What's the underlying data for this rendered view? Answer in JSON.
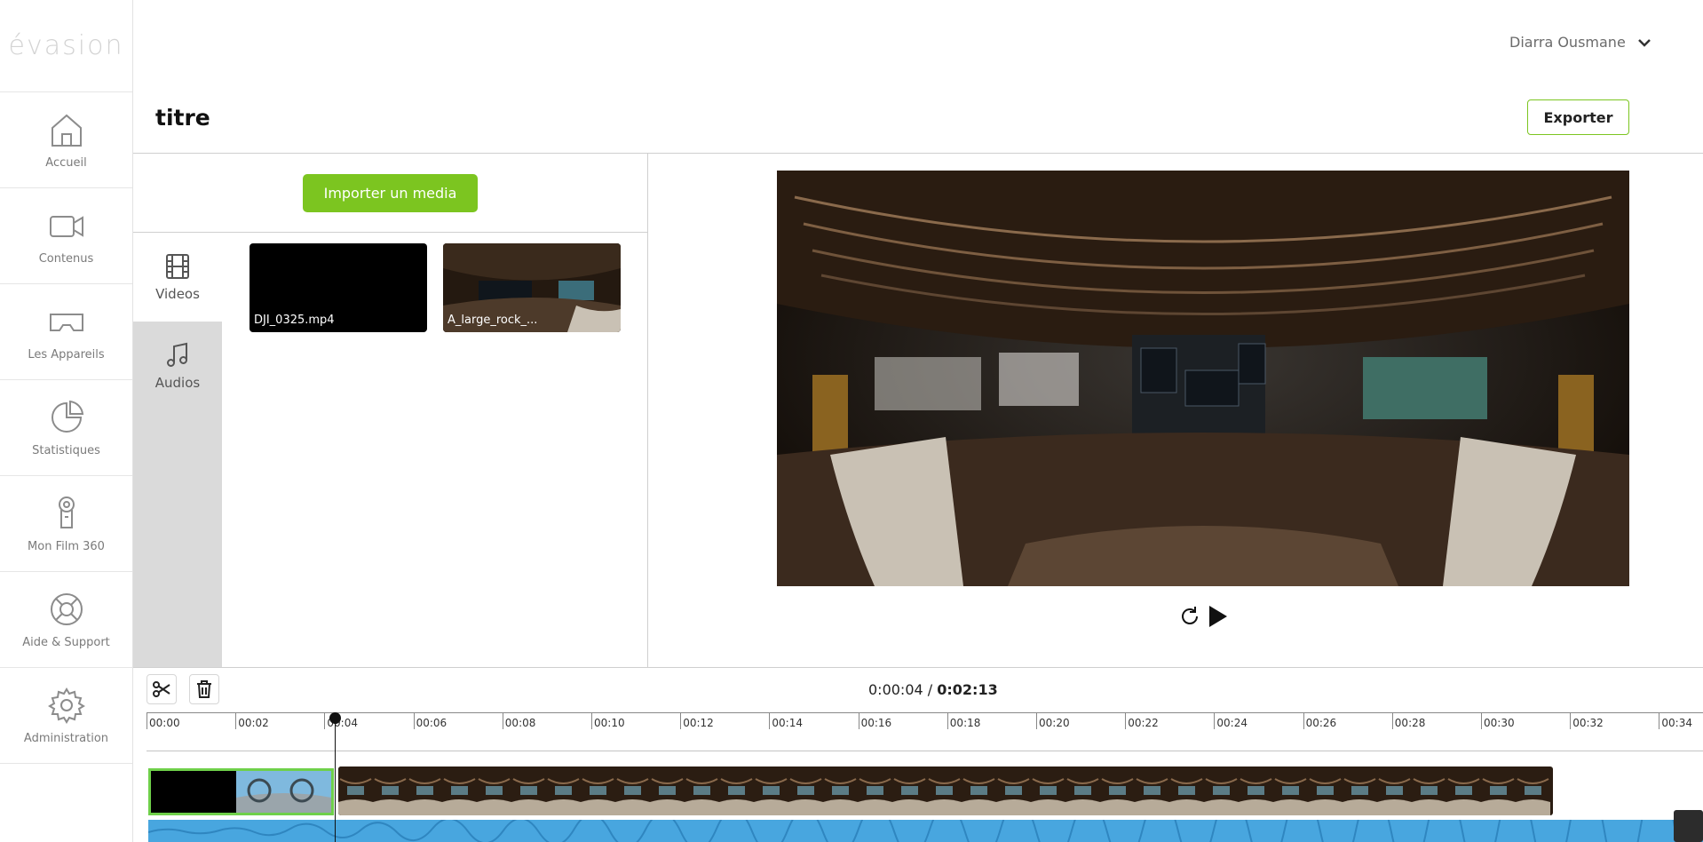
{
  "app": {
    "logo": "évasion"
  },
  "sidebar": {
    "items": [
      {
        "label": "Accueil",
        "icon": "home-icon"
      },
      {
        "label": "Contenus",
        "icon": "video-camera-icon"
      },
      {
        "label": "Les Appareils",
        "icon": "vr-headset-icon"
      },
      {
        "label": "Statistiques",
        "icon": "pie-chart-icon"
      },
      {
        "label": "Mon Film 360",
        "icon": "camera-360-icon"
      },
      {
        "label": "Aide & Support",
        "icon": "lifebuoy-icon"
      },
      {
        "label": "Administration",
        "icon": "gear-icon"
      }
    ]
  },
  "header": {
    "user_name": "Diarra Ousmane",
    "title": "titre",
    "export_label": "Exporter"
  },
  "media": {
    "import_label": "Importer un media",
    "tabs": [
      {
        "label": "Videos",
        "icon": "film-icon",
        "active": true
      },
      {
        "label": "Audios",
        "icon": "music-note-icon",
        "active": false
      }
    ],
    "items": [
      {
        "name": "DJI_0325.mp4"
      },
      {
        "name": "A_large_rock_..."
      }
    ]
  },
  "player": {
    "current_time": "0:00:04",
    "separator": " / ",
    "total_time": "0:02:13"
  },
  "timeline": {
    "ruler_labels": [
      "00:00",
      "00:02",
      "00:04",
      "00:06",
      "00:08",
      "00:10",
      "00:12",
      "00:14",
      "00:16",
      "00:18",
      "00:20",
      "00:22",
      "00:24",
      "00:26",
      "00:28",
      "00:30",
      "00:32",
      "00:34"
    ],
    "playhead_seconds": 4
  },
  "colors": {
    "accent": "#7cc520",
    "audio": "#48a6df",
    "clip_selected_border": "#6fd04a"
  }
}
